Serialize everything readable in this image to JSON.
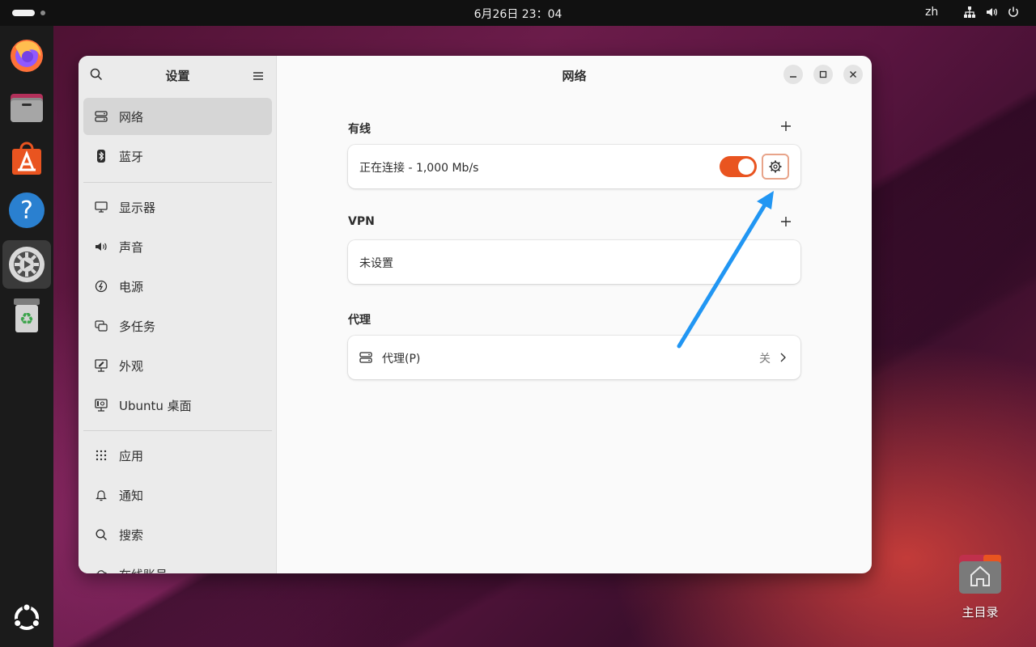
{
  "topbar": {
    "clock": "6月26日  23：04",
    "language": "zh"
  },
  "dock": {
    "apps": [
      {
        "icon": "firefox-icon"
      },
      {
        "icon": "files-icon"
      },
      {
        "icon": "app-center-icon"
      },
      {
        "icon": "help-icon"
      },
      {
        "icon": "settings-icon"
      },
      {
        "icon": "trash-icon"
      }
    ],
    "show_apps_icon": "ubuntu-logo-icon"
  },
  "desktop": {
    "home_label": "主目录"
  },
  "sidebar": {
    "title": "设置",
    "items": [
      {
        "label": "网络",
        "icon": "network-icon"
      },
      {
        "label": "蓝牙",
        "icon": "bluetooth-icon"
      },
      {
        "label": "显示器",
        "icon": "display-icon"
      },
      {
        "label": "声音",
        "icon": "sound-icon"
      },
      {
        "label": "电源",
        "icon": "power-icon"
      },
      {
        "label": "多任务",
        "icon": "multitasking-icon"
      },
      {
        "label": "外观",
        "icon": "appearance-icon"
      },
      {
        "label": "Ubuntu 桌面",
        "icon": "ubuntu-desktop-icon"
      },
      {
        "label": "应用",
        "icon": "apps-grid-icon"
      },
      {
        "label": "通知",
        "icon": "bell-icon"
      },
      {
        "label": "搜索",
        "icon": "search-icon"
      },
      {
        "label": "在线账号",
        "icon": "cloud-icon"
      }
    ]
  },
  "main": {
    "title": "网络",
    "wired": {
      "section_title": "有线",
      "status": "正在连接 - 1,000 Mb/s",
      "toggle_on": true
    },
    "vpn": {
      "section_title": "VPN",
      "status": "未设置"
    },
    "proxy": {
      "section_title": "代理",
      "label": "代理(P)",
      "status": "关"
    }
  },
  "colors": {
    "accent": "#e95420",
    "annotation_arrow": "#2196f3"
  }
}
